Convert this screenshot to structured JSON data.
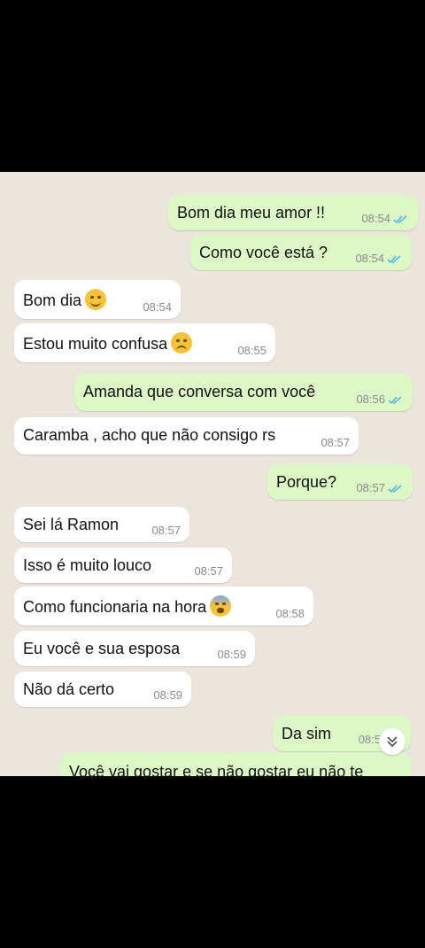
{
  "messages": [
    {
      "text": "Bom dia meu amor !!",
      "time": "08:54"
    },
    {
      "text": "Como você está ?",
      "time": "08:54"
    },
    {
      "text": "Bom dia",
      "time": "08:54",
      "emoji": "smile-emoji"
    },
    {
      "text": "Estou muito confusa",
      "time": "08:55",
      "emoji": "sad-emoji"
    },
    {
      "text": "Amanda que conversa com você",
      "time": "08:56"
    },
    {
      "text": "Caramba , acho que não consigo rs",
      "time": "08:57"
    },
    {
      "text": "Porque?",
      "time": "08:57"
    },
    {
      "text": "Sei lá Ramon",
      "time": "08:57"
    },
    {
      "text": "Isso é muito louco",
      "time": "08:57"
    },
    {
      "text": "Como funcionaria na hora",
      "time": "08:58",
      "emoji": "fearful-emoji"
    },
    {
      "text": "Eu você e sua esposa",
      "time": "08:59"
    },
    {
      "text": "Não dá certo",
      "time": "08:59"
    },
    {
      "text": "Da sim",
      "time": "08:5"
    },
    {
      "text": "Você vai gostar e se não gostar eu não te"
    }
  ],
  "colors": {
    "outgoing": "#dcf8c6",
    "incoming": "#ffffff",
    "read_ticks": "#4fb6ec",
    "background": "#ece5dd"
  }
}
